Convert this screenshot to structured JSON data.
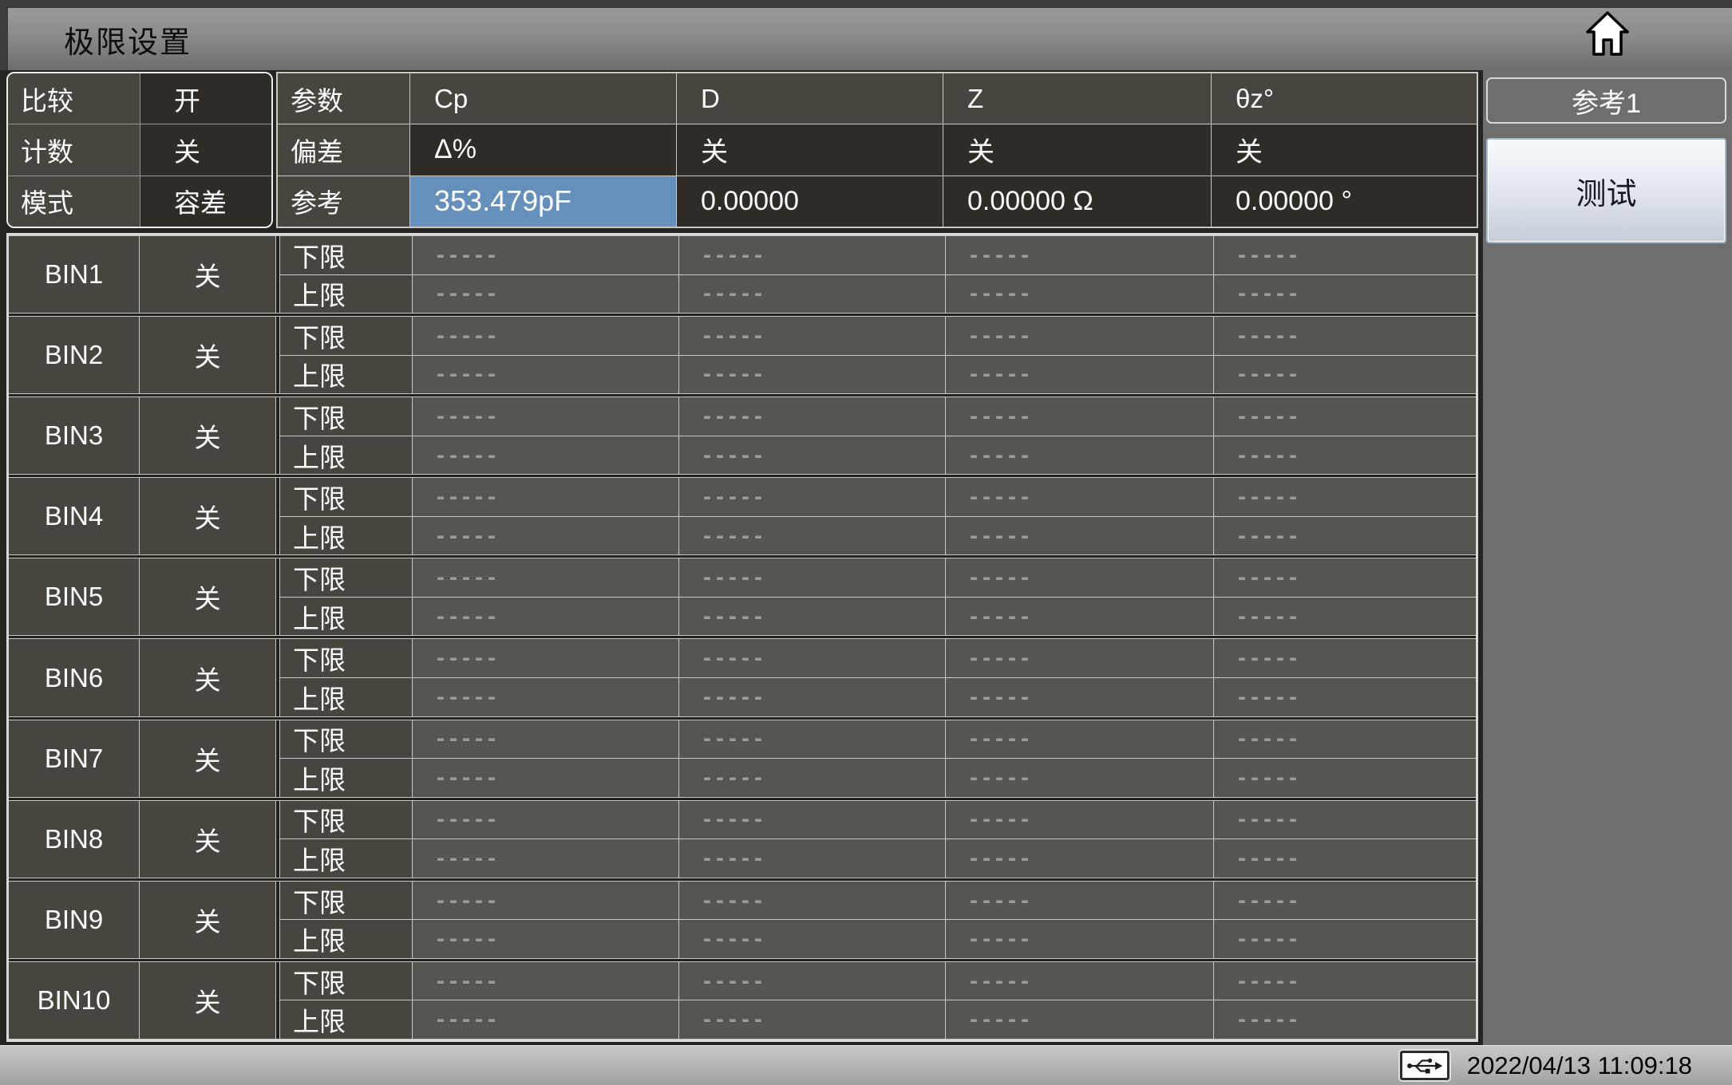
{
  "title_bar": {
    "title": "极限设置",
    "home_icon": "home-icon"
  },
  "comparator_panel": {
    "rows": [
      {
        "label": "比较",
        "value": "开"
      },
      {
        "label": "计数",
        "value": "关"
      },
      {
        "label": "模式",
        "value": "容差"
      }
    ]
  },
  "param_table": {
    "rows": [
      {
        "label": "参数",
        "values": [
          "Cp",
          "D",
          "Z",
          "θz°"
        ]
      },
      {
        "label": "偏差",
        "values": [
          "Δ%",
          "关",
          "关",
          "关"
        ]
      },
      {
        "label": "参考",
        "values": [
          "353.479pF",
          "0.00000",
          "0.00000 Ω",
          "0.00000 °"
        ]
      }
    ],
    "highlight_cell": {
      "row": 2,
      "col": 0
    }
  },
  "bin_table": {
    "limit_labels": [
      "下限",
      "上限"
    ],
    "placeholder": "-----",
    "bins": [
      {
        "name": "BIN1",
        "state": "关"
      },
      {
        "name": "BIN2",
        "state": "关"
      },
      {
        "name": "BIN3",
        "state": "关"
      },
      {
        "name": "BIN4",
        "state": "关"
      },
      {
        "name": "BIN5",
        "state": "关"
      },
      {
        "name": "BIN6",
        "state": "关"
      },
      {
        "name": "BIN7",
        "state": "关"
      },
      {
        "name": "BIN8",
        "state": "关"
      },
      {
        "name": "BIN9",
        "state": "关"
      },
      {
        "name": "BIN10",
        "state": "关"
      }
    ]
  },
  "side_panel": {
    "reference_label": "参考1",
    "test_button_label": "测试"
  },
  "status_bar": {
    "usb_icon": "usb-icon",
    "datetime": "2022/04/13 11:09:18"
  },
  "colors": {
    "highlight": "#6690bc",
    "panel_gray": "#6e6e6e",
    "label_cell": "#48443e",
    "dark_cell": "#2f2b27",
    "value_cell": "#575550"
  }
}
